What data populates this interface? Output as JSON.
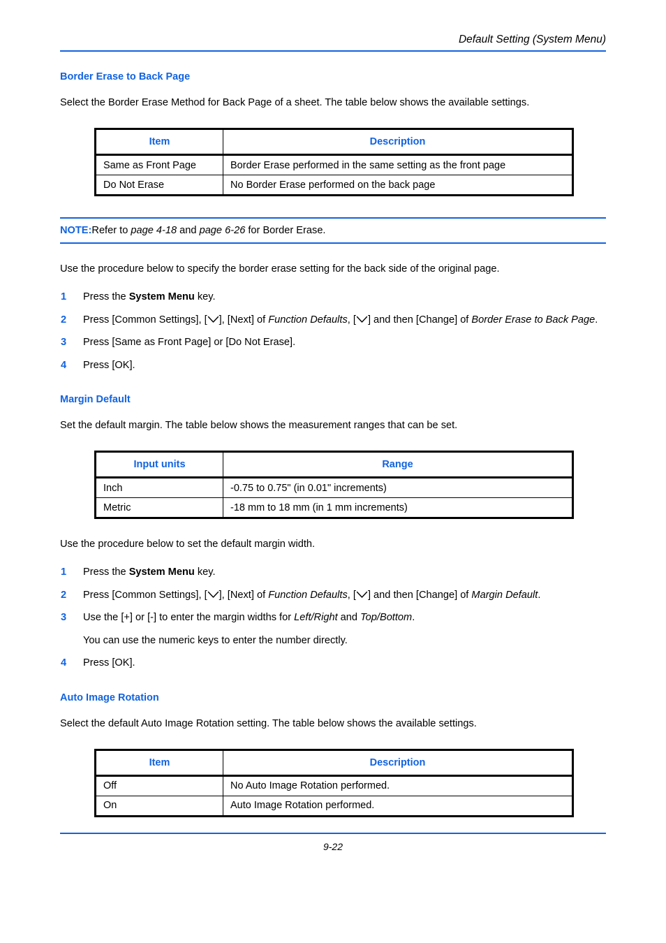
{
  "header": {
    "title": "Default Setting (System Menu)"
  },
  "colors": {
    "accent_blue": "#1263e0",
    "rule_blue": "#1263e0",
    "text_black": "#000000",
    "page_background": "#ffffff"
  },
  "sections": {
    "border_erase": {
      "heading": "Border Erase to Back Page",
      "intro": "Select the Border Erase Method for Back Page of a sheet. The table below shows the available settings.",
      "table": {
        "headers": [
          "Item",
          "Description"
        ],
        "rows": [
          [
            "Same as Front Page",
            "Border Erase performed in the same setting as the front page"
          ],
          [
            "Do Not Erase",
            "No Border Erase performed on the back page"
          ]
        ]
      },
      "note": {
        "label": "NOTE:",
        "text_1": "Refer to ",
        "ref_1": "page 4-18",
        "text_2": " and ",
        "ref_2": "page 6-26",
        "text_3": " for Border Erase."
      },
      "procedure_intro": "Use the procedure below to specify the border erase setting for the back side of the original page.",
      "steps": [
        {
          "num": "1",
          "parts": [
            {
              "t": "Press the ",
              "s": "normal"
            },
            {
              "t": "System Menu",
              "s": "bold"
            },
            {
              "t": " key.",
              "s": "normal"
            }
          ]
        },
        {
          "num": "2",
          "parts": [
            {
              "t": "Press [Common Settings], [",
              "s": "normal"
            },
            {
              "t": "chevron-down",
              "s": "key"
            },
            {
              "t": "], [Next] of ",
              "s": "normal"
            },
            {
              "t": "Function Defaults",
              "s": "italic"
            },
            {
              "t": ", [",
              "s": "normal"
            },
            {
              "t": "chevron-down",
              "s": "key"
            },
            {
              "t": "] and then [Change] of ",
              "s": "normal"
            },
            {
              "t": "Border Erase to Back Page",
              "s": "italic"
            },
            {
              "t": ".",
              "s": "normal"
            }
          ]
        },
        {
          "num": "3",
          "parts": [
            {
              "t": "Press [Same as Front Page] or [Do Not Erase].",
              "s": "normal"
            }
          ]
        },
        {
          "num": "4",
          "parts": [
            {
              "t": "Press [OK].",
              "s": "normal"
            }
          ]
        }
      ]
    },
    "margin_default": {
      "heading": "Margin Default",
      "intro": "Set the default margin. The table below shows the measurement ranges that can be set.",
      "table": {
        "headers": [
          "Input units",
          "Range"
        ],
        "rows": [
          [
            "Inch",
            "-0.75 to 0.75\" (in 0.01\" increments)"
          ],
          [
            "Metric",
            "-18 mm to 18 mm (in 1 mm increments)"
          ]
        ]
      },
      "procedure_intro": "Use the procedure below to set the default margin width.",
      "steps": [
        {
          "num": "1",
          "parts": [
            {
              "t": "Press the ",
              "s": "normal"
            },
            {
              "t": "System Menu",
              "s": "bold"
            },
            {
              "t": " key.",
              "s": "normal"
            }
          ]
        },
        {
          "num": "2",
          "parts": [
            {
              "t": "Press [Common Settings], [",
              "s": "normal"
            },
            {
              "t": "chevron-down",
              "s": "key"
            },
            {
              "t": "], [Next] of ",
              "s": "normal"
            },
            {
              "t": "Function Defaults",
              "s": "italic"
            },
            {
              "t": ", [",
              "s": "normal"
            },
            {
              "t": "chevron-down",
              "s": "key"
            },
            {
              "t": "] and then [Change] of ",
              "s": "normal"
            },
            {
              "t": "Margin Default",
              "s": "italic"
            },
            {
              "t": ".",
              "s": "normal"
            }
          ]
        },
        {
          "num": "3",
          "parts": [
            {
              "t": "Use the [+] or [-] to enter the margin widths for ",
              "s": "normal"
            },
            {
              "t": "Left/Right",
              "s": "italic"
            },
            {
              "t": " and ",
              "s": "normal"
            },
            {
              "t": "Top/Bottom",
              "s": "italic"
            },
            {
              "t": ".",
              "s": "normal"
            }
          ]
        }
      ],
      "substep": "You can use the numeric keys to enter the number directly.",
      "final_step": {
        "num": "4",
        "parts": [
          {
            "t": "Press [OK].",
            "s": "normal"
          }
        ]
      }
    },
    "auto_image_rotation": {
      "heading": "Auto Image Rotation",
      "intro": "Select the default Auto Image Rotation setting. The table below shows the available settings.",
      "table": {
        "headers": [
          "Item",
          "Description"
        ],
        "rows": [
          [
            "Off",
            "No Auto Image Rotation performed."
          ],
          [
            "On",
            "Auto Image Rotation performed."
          ]
        ]
      }
    }
  },
  "footer": {
    "page_number": "9-22"
  }
}
